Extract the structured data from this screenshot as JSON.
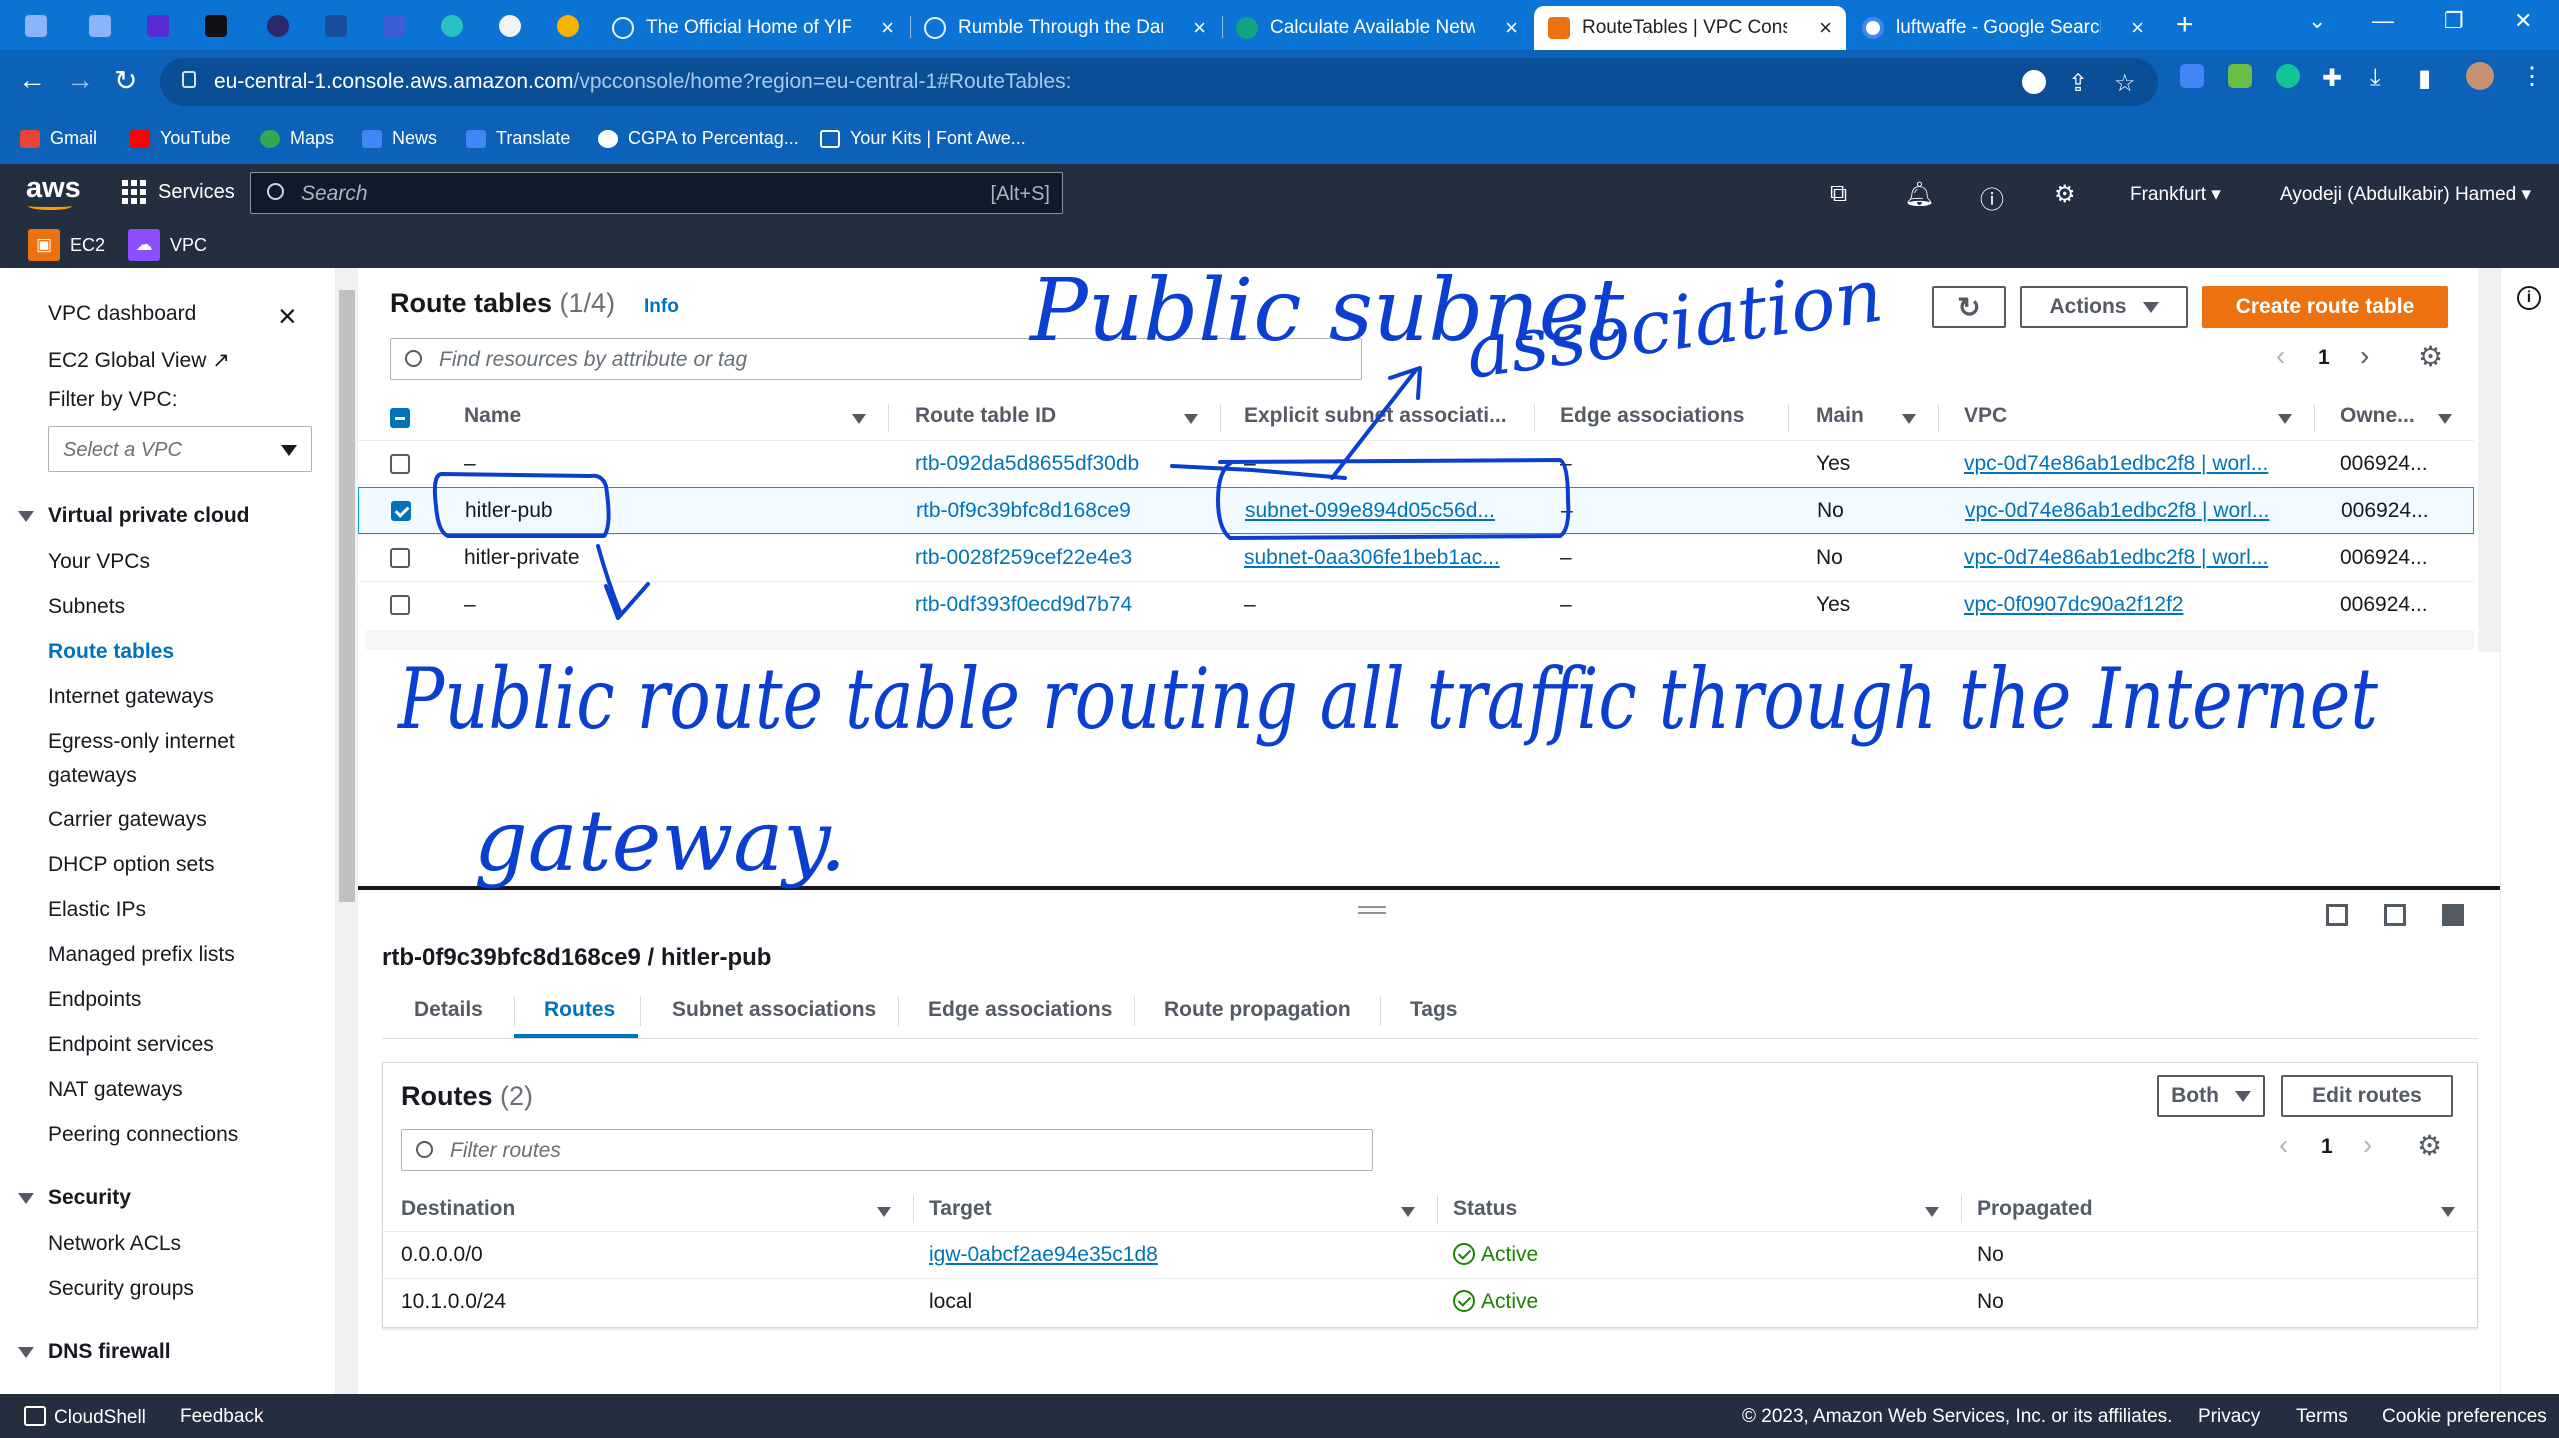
{
  "browser": {
    "tabs": [
      {
        "title": "The Official Home of YIFY",
        "icon_color": "#e8f0fe"
      },
      {
        "title": "Rumble Through the Dark",
        "icon_color": "#e8f0fe"
      },
      {
        "title": "Calculate Available Netwo",
        "icon_color": "#10a37f"
      },
      {
        "title": "RouteTables | VPC Console",
        "icon_color": "#ec7211"
      },
      {
        "title": "luftwaffe - Google Search",
        "icon_color": "#4285f4"
      }
    ],
    "new_tab": "+",
    "url_host": "eu-central-1.console.aws.amazon.com",
    "url_path": "/vpcconsole/home?region=eu-central-1#RouteTables:",
    "bookmarks": [
      "Gmail",
      "YouTube",
      "Maps",
      "News",
      "Translate",
      "CGPA to Percentag...",
      "Your Kits | Font Awe..."
    ]
  },
  "aws": {
    "logo": "aws",
    "services": "Services",
    "search_placeholder": "Search",
    "search_shortcut": "[Alt+S]",
    "region": "Frankfurt",
    "user": "Ayodeji (Abdulkabir) Hamed",
    "favorites": [
      {
        "label": "EC2",
        "color": "#ec7211"
      },
      {
        "label": "VPC",
        "color": "#8c4fff"
      }
    ]
  },
  "sidebar": {
    "dashboard": "VPC dashboard",
    "global_view": "EC2 Global View",
    "filter_label": "Filter by VPC:",
    "filter_placeholder": "Select a VPC",
    "section_vpc": "Virtual private cloud",
    "vpc_items": [
      "Your VPCs",
      "Subnets",
      "Route tables",
      "Internet gateways",
      "Egress-only internet",
      "gateways",
      "Carrier gateways",
      "DHCP option sets",
      "Elastic IPs",
      "Managed prefix lists",
      "Endpoints",
      "Endpoint services",
      "NAT gateways",
      "Peering connections"
    ],
    "section_security": "Security",
    "security_items": [
      "Network ACLs",
      "Security groups"
    ],
    "section_dns": "DNS firewall"
  },
  "route_tables": {
    "title": "Route tables",
    "count": "(1/4)",
    "info": "Info",
    "actions": "Actions",
    "create": "Create route table",
    "filter_placeholder": "Find resources by attribute or tag",
    "page": "1",
    "columns": [
      "Name",
      "Route table ID",
      "Explicit subnet associati...",
      "Edge associations",
      "Main",
      "VPC",
      "Owne..."
    ],
    "rows": [
      {
        "name": "–",
        "id": "rtb-092da5d8655df30db",
        "subnet": "–",
        "edge": "–",
        "main": "Yes",
        "vpc": "vpc-0d74e86ab1edbc2f8 | worl...",
        "owner": "006924...",
        "selected": false
      },
      {
        "name": "hitler-pub",
        "id": "rtb-0f9c39bfc8d168ce9",
        "subnet": "subnet-099e894d05c56d...",
        "edge": "–",
        "main": "No",
        "vpc": "vpc-0d74e86ab1edbc2f8 | worl...",
        "owner": "006924...",
        "selected": true
      },
      {
        "name": "hitler-private",
        "id": "rtb-0028f259cef22e4e3",
        "subnet": "subnet-0aa306fe1beb1ac...",
        "edge": "–",
        "main": "No",
        "vpc": "vpc-0d74e86ab1edbc2f8 | worl...",
        "owner": "006924...",
        "selected": false
      },
      {
        "name": "–",
        "id": "rtb-0df393f0ecd9d7b74",
        "subnet": "–",
        "edge": "–",
        "main": "Yes",
        "vpc": "vpc-0f0907dc90a2f12f2",
        "owner": "006924...",
        "selected": false
      }
    ]
  },
  "detail": {
    "heading": "rtb-0f9c39bfc8d168ce9 / hitler-pub",
    "tabs": [
      "Details",
      "Routes",
      "Subnet associations",
      "Edge associations",
      "Route propagation",
      "Tags"
    ],
    "active_tab": "Routes",
    "routes_title": "Routes",
    "routes_count": "(2)",
    "both": "Both",
    "edit_routes": "Edit routes",
    "filter_placeholder": "Filter routes",
    "page": "1",
    "columns": [
      "Destination",
      "Target",
      "Status",
      "Propagated"
    ],
    "routes": [
      {
        "destination": "0.0.0.0/0",
        "target": "igw-0abcf2ae94e35c1d8",
        "status": "Active",
        "propagated": "No"
      },
      {
        "destination": "10.1.0.0/24",
        "target": "local",
        "status": "Active",
        "propagated": "No"
      }
    ]
  },
  "annotations": {
    "line1": "Public subnet",
    "line2": "association",
    "line3": "Public route table routing all traffic through the Internet",
    "line4": "gateway.",
    "ink_color": "#0a3fcf"
  },
  "footer": {
    "cloudshell": "CloudShell",
    "feedback": "Feedback",
    "copyright": "© 2023, Amazon Web Services, Inc. or its affiliates.",
    "privacy": "Privacy",
    "terms": "Terms",
    "cookies": "Cookie preferences"
  }
}
